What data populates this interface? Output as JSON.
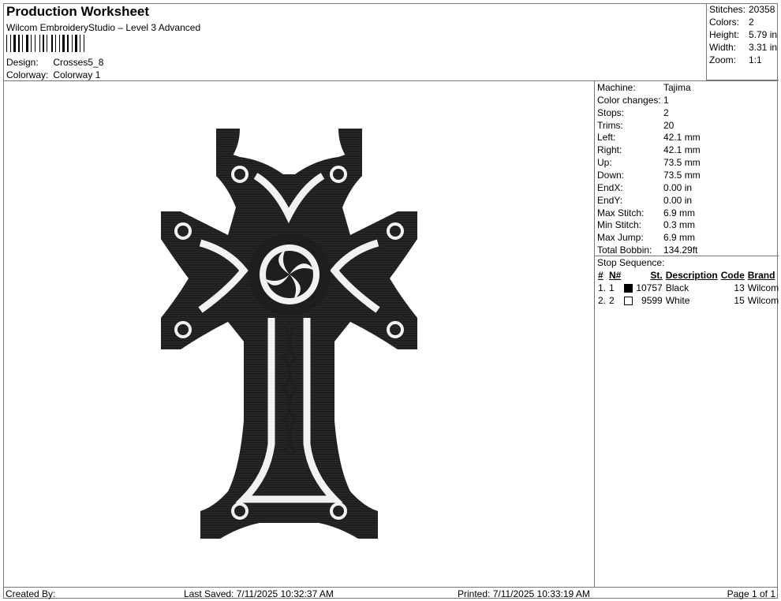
{
  "header": {
    "title": "Production Worksheet",
    "software": "Wilcom EmbroideryStudio – Level 3 Advanced",
    "design_label": "Design:",
    "design_value": "Crosses5_8",
    "colorway_label": "Colorway:",
    "colorway_value": "Colorway 1"
  },
  "summary": [
    {
      "label": "Stitches:",
      "value": "20358"
    },
    {
      "label": "Colors:",
      "value": "2"
    },
    {
      "label": "Height:",
      "value": "5.79 in"
    },
    {
      "label": "Width:",
      "value": "3.31 in"
    },
    {
      "label": "Zoom:",
      "value": "1:1"
    }
  ],
  "machine_info": [
    {
      "label": "Machine:",
      "value": "Tajima"
    },
    {
      "label": "Color changes:",
      "value": "1"
    },
    {
      "label": "Stops:",
      "value": "2"
    },
    {
      "label": "Trims:",
      "value": "20"
    },
    {
      "label": "Left:",
      "value": "42.1 mm"
    },
    {
      "label": "Right:",
      "value": "42.1 mm"
    },
    {
      "label": "Up:",
      "value": "73.5 mm"
    },
    {
      "label": "Down:",
      "value": "73.5 mm"
    },
    {
      "label": "EndX:",
      "value": "0.00 in"
    },
    {
      "label": "EndY:",
      "value": "0.00 in"
    },
    {
      "label": "Max Stitch:",
      "value": "6.9 mm"
    },
    {
      "label": "Min Stitch:",
      "value": "0.3 mm"
    },
    {
      "label": "Max Jump:",
      "value": "6.9 mm"
    },
    {
      "label": "Total Bobbin:",
      "value": "134.29ft"
    }
  ],
  "stop_sequence": {
    "title": "Stop Sequence:",
    "headers": {
      "num": "#",
      "needle": "N#",
      "stitches": "St.",
      "description": "Description",
      "code": "Code",
      "brand": "Brand"
    },
    "rows": [
      {
        "num": "1.",
        "needle": "1",
        "swatch": "#000000",
        "stitches": "10757",
        "description": "Black",
        "code": "13",
        "brand": "Wilcom"
      },
      {
        "num": "2.",
        "needle": "2",
        "swatch": "#ffffff",
        "stitches": "9599",
        "description": "White",
        "code": "15",
        "brand": "Wilcom"
      }
    ]
  },
  "footer": {
    "created_by": "Created By:",
    "last_saved": "Last Saved: 7/11/2025 10:32:37 AM",
    "printed": "Printed: 7/11/2025 10:33:19 AM",
    "page": "Page 1 of 1"
  },
  "design_colors": {
    "thread_dark": "#1e1e1e",
    "thread_light": "#f2f2f2"
  }
}
